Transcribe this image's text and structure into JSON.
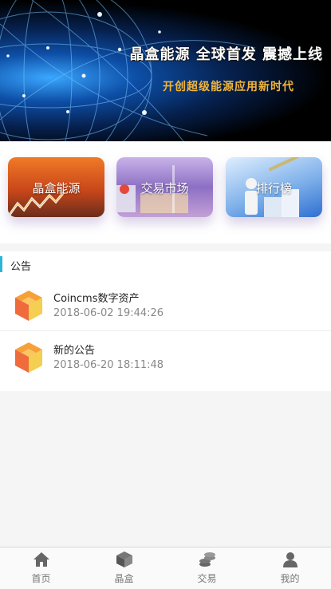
{
  "banner": {
    "title": "晶盒能源 全球首发 震撼上线",
    "subtitle": "开创超级能源应用新时代"
  },
  "cards": [
    {
      "label": "晶盒能源"
    },
    {
      "label": "交易市场"
    },
    {
      "label": "排行榜"
    }
  ],
  "notice": {
    "title": "公告",
    "items": [
      {
        "title": "Coincms数字资产",
        "time": "2018-06-02 19:44:26"
      },
      {
        "title": "新的公告",
        "time": "2018-06-20 18:11:48"
      }
    ]
  },
  "tabbar": {
    "items": [
      {
        "label": "首页",
        "icon": "home-icon"
      },
      {
        "label": "晶盒",
        "icon": "box-icon"
      },
      {
        "label": "交易",
        "icon": "coins-icon"
      },
      {
        "label": "我的",
        "icon": "user-icon"
      }
    ]
  }
}
